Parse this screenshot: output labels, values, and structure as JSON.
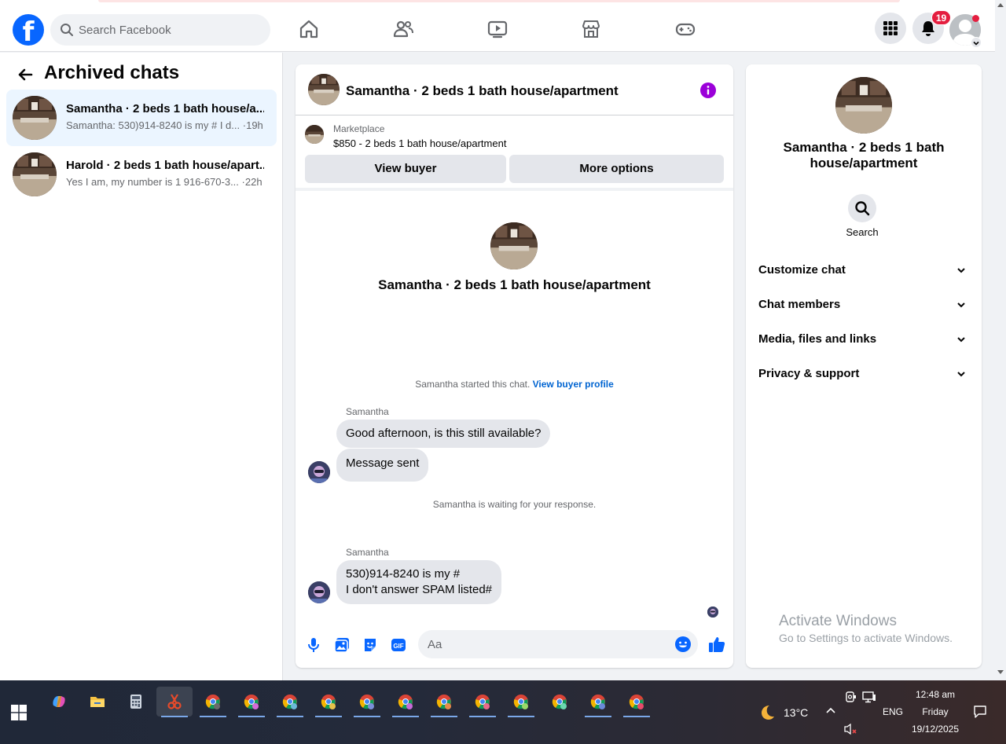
{
  "nav": {
    "logo": "f",
    "search_placeholder": "Search Facebook",
    "notification_count": "19"
  },
  "left": {
    "title": "Archived chats",
    "chats": [
      {
        "name": "Samantha · 2 beds 1 bath house/a...",
        "snippet": "Samantha: 530)914-8240 is my # I d...",
        "time": "·19h"
      },
      {
        "name": "Harold · 2 beds 1 bath house/apart...",
        "snippet": "Yes I am, my number is 1 916-670-3...",
        "time": "·22h"
      }
    ]
  },
  "chat": {
    "title": "Samantha · 2 beds 1 bath house/apartment",
    "marketplace_label": "Marketplace",
    "listing": "$850 - 2 beds 1 bath house/apartment",
    "view_buyer": "View buyer",
    "more_options": "More options",
    "conversation_title": "Samantha · 2 beds 1 bath house/apartment",
    "started_text": "Samantha started this chat.",
    "view_profile_link": "View buyer profile",
    "sender1": "Samantha",
    "msg1": "Good afternoon, is this still available?",
    "msg2": "Message sent",
    "waiting_text": "Samantha is waiting for your response.",
    "sender2": "Samantha",
    "msg3_line1": "530)914-8240 is my #",
    "msg3_line2": "I don't answer SPAM listed#",
    "input_placeholder": "Aa"
  },
  "right": {
    "title": "Samantha · 2 beds 1 bath house/apartment",
    "search_label": "Search",
    "sections": [
      "Customize chat",
      "Chat members",
      "Media, files and links",
      "Privacy & support"
    ],
    "watermark_line1": "Activate Windows",
    "watermark_line2": "Go to Settings to activate Windows."
  },
  "taskbar": {
    "weather": "13°C",
    "lang": "ENG",
    "time": "12:48 am",
    "day": "Friday",
    "date": "19/12/2025"
  },
  "colors": {
    "brand": "#0866ff",
    "link": "#0064d1",
    "badge": "#e41e3f",
    "info": "#9b00d9"
  }
}
